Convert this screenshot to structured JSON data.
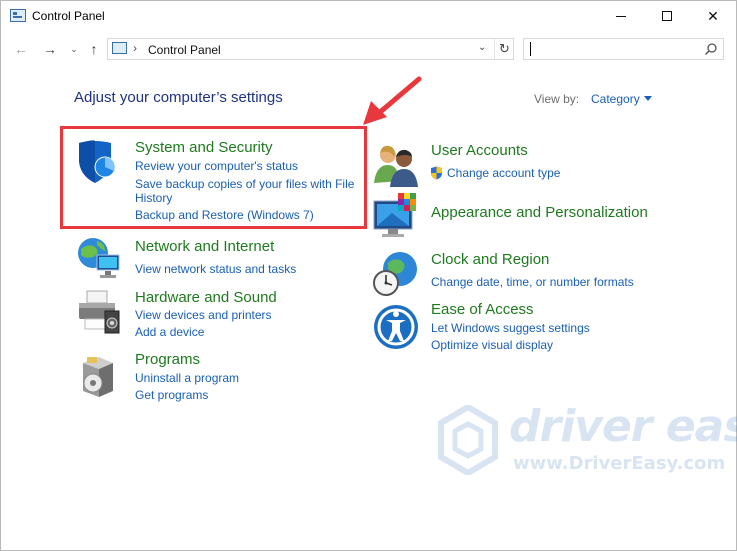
{
  "window": {
    "title": "Control Panel",
    "minimize_glyph": "—",
    "maximize_glyph": "□",
    "close_glyph": "✕"
  },
  "nav": {
    "back_glyph": "←",
    "forward_glyph": "→",
    "recent_glyph": "⌄",
    "up_glyph": "↑",
    "address_separator": "›",
    "address_text": "Control Panel",
    "address_dropdown_glyph": "⌄",
    "refresh_glyph": "↻",
    "search_value": "",
    "search_placeholder": ""
  },
  "content": {
    "heading": "Adjust your computer’s settings",
    "view_by_label": "View by:",
    "view_by_value": "Category"
  },
  "categories_left": [
    {
      "title": "System and Security",
      "icon": "shield-icon",
      "links": [
        "Review your computer's status",
        "Save backup copies of your files with File",
        "History",
        "Backup and Restore (Windows 7)"
      ]
    },
    {
      "title": "Network and Internet",
      "icon": "network-globe-icon",
      "links": [
        "View network status and tasks"
      ]
    },
    {
      "title": "Hardware and Sound",
      "icon": "printer-icon",
      "links": [
        "View devices and printers",
        "Add a device"
      ]
    },
    {
      "title": "Programs",
      "icon": "programs-box-icon",
      "links": [
        "Uninstall a program",
        "Get programs"
      ]
    }
  ],
  "categories_right": [
    {
      "title": "User Accounts",
      "icon": "users-icon",
      "links": [
        "Change account type"
      ]
    },
    {
      "title": "Appearance and Personalization",
      "icon": "monitor-palette-icon",
      "links": []
    },
    {
      "title": "Clock and Region",
      "icon": "clock-globe-icon",
      "links": [
        "Change date, time, or number formats"
      ]
    },
    {
      "title": "Ease of Access",
      "icon": "ease-of-access-icon",
      "links": [
        "Let Windows suggest settings",
        "Optimize visual display"
      ]
    }
  ],
  "watermark": {
    "brand": "driver easy",
    "url": "www.DriverEasy.com"
  },
  "colors": {
    "link": "#1a5fb4",
    "category_title": "#1f7a1f",
    "heading": "#1e3287",
    "annotation": "#e8383d"
  }
}
